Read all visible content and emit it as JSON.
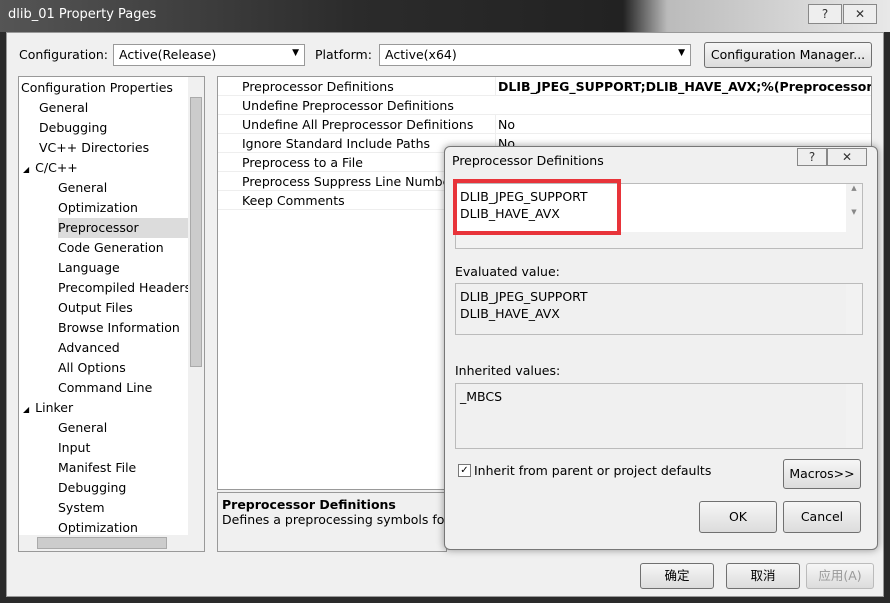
{
  "window": {
    "title": "dlib_01 Property Pages",
    "help": "?",
    "close": "✕"
  },
  "config": {
    "label": "Configuration:",
    "value": "Active(Release)",
    "platform_label": "Platform:",
    "platform_value": "Active(x64)",
    "manager_button": "Configuration Manager..."
  },
  "tree": [
    {
      "label": "Configuration Properties",
      "indent": 0
    },
    {
      "label": "General",
      "indent": 1
    },
    {
      "label": "Debugging",
      "indent": 1
    },
    {
      "label": "VC++ Directories",
      "indent": 1
    },
    {
      "label": "C/C++",
      "indent": 1,
      "expander": "◢"
    },
    {
      "label": "General",
      "indent": 2
    },
    {
      "label": "Optimization",
      "indent": 2
    },
    {
      "label": "Preprocessor",
      "indent": 2,
      "selected": true
    },
    {
      "label": "Code Generation",
      "indent": 2
    },
    {
      "label": "Language",
      "indent": 2
    },
    {
      "label": "Precompiled Headers",
      "indent": 2
    },
    {
      "label": "Output Files",
      "indent": 2
    },
    {
      "label": "Browse Information",
      "indent": 2
    },
    {
      "label": "Advanced",
      "indent": 2
    },
    {
      "label": "All Options",
      "indent": 2
    },
    {
      "label": "Command Line",
      "indent": 2
    },
    {
      "label": "Linker",
      "indent": 1,
      "expander": "◢"
    },
    {
      "label": "General",
      "indent": 2
    },
    {
      "label": "Input",
      "indent": 2
    },
    {
      "label": "Manifest File",
      "indent": 2
    },
    {
      "label": "Debugging",
      "indent": 2
    },
    {
      "label": "System",
      "indent": 2
    },
    {
      "label": "Optimization",
      "indent": 2
    }
  ],
  "grid": [
    {
      "name": "Preprocessor Definitions",
      "value": "DLIB_JPEG_SUPPORT;DLIB_HAVE_AVX;%(PreprocessorDefinitions)",
      "bold": true
    },
    {
      "name": "Undefine Preprocessor Definitions",
      "value": ""
    },
    {
      "name": "Undefine All Preprocessor Definitions",
      "value": "No"
    },
    {
      "name": "Ignore Standard Include Paths",
      "value": "No"
    },
    {
      "name": "Preprocess to a File",
      "value": ""
    },
    {
      "name": "Preprocess Suppress Line Numbers",
      "value": ""
    },
    {
      "name": "Keep Comments",
      "value": ""
    }
  ],
  "description": {
    "title": "Preprocessor Definitions",
    "text": "Defines a preprocessing symbols for y"
  },
  "dialog": {
    "title": "Preprocessor Definitions",
    "help": "?",
    "close": "✕",
    "edit_text": "DLIB_JPEG_SUPPORT\nDLIB_HAVE_AVX",
    "evaluated_label": "Evaluated value:",
    "evaluated_text": "DLIB_JPEG_SUPPORT\nDLIB_HAVE_AVX",
    "inherited_label": "Inherited values:",
    "inherited_text": "_MBCS",
    "inherit_checkbox": "Inherit from parent or project defaults",
    "inherit_checked": true,
    "macros": "Macros>>",
    "ok": "OK",
    "cancel": "Cancel",
    "highlight_color": "#e8343a"
  },
  "footer": {
    "ok": "确定",
    "cancel": "取消",
    "apply": "应用(A)"
  }
}
